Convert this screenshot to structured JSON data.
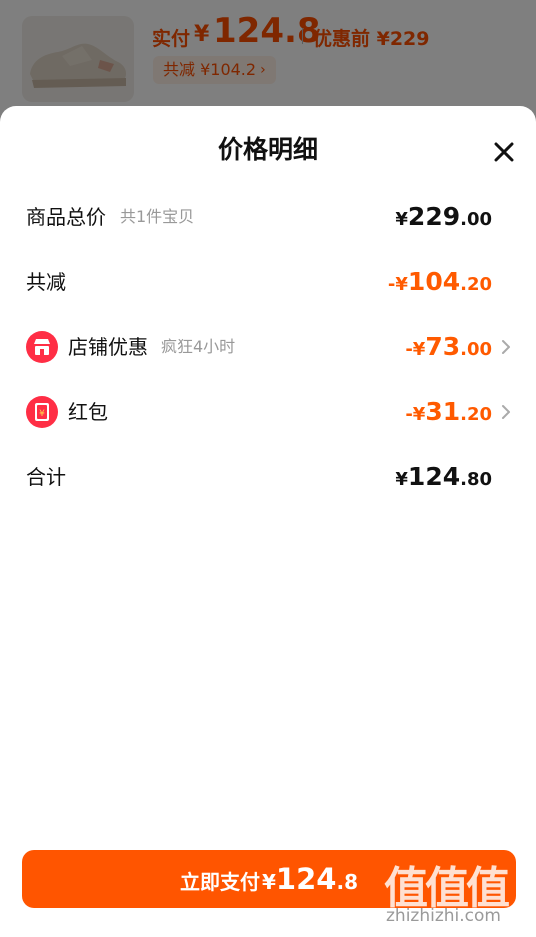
{
  "background": {
    "pay_label": "实付",
    "pay_yen": "¥",
    "pay_amount": "124.8",
    "before_label": "优惠前 ¥229",
    "reduce_chip": "共减 ¥104.2",
    "reduce_chevron": "›"
  },
  "sheet": {
    "title": "价格明细",
    "close_icon": "close-icon"
  },
  "rows": {
    "total": {
      "label": "商品总价",
      "sub": "共1件宝贝",
      "sym": "¥",
      "int": "229",
      "dec": ".00"
    },
    "reduced": {
      "label": "共减",
      "sym": "-¥",
      "int": "104",
      "dec": ".20"
    },
    "shop": {
      "label": "店铺优惠",
      "sub": "疯狂4小时",
      "sym": "-¥",
      "int": "73",
      "dec": ".00",
      "icon": "shop-icon"
    },
    "redpacket": {
      "label": "红包",
      "sym": "-¥",
      "int": "31",
      "dec": ".20",
      "icon": "red-packet-icon"
    },
    "sum": {
      "label": "合计",
      "sym": "¥",
      "int": "124",
      "dec": ".80"
    }
  },
  "pay_button": {
    "label": "立即支付",
    "sym": "¥",
    "int": "124",
    "dec": ".8"
  },
  "watermark": {
    "logo": "值值值",
    "site": "zhizhizhi.com"
  },
  "colors": {
    "accent": "#ff5500",
    "discount": "#ff5a00",
    "icon_red": "#ff2e45"
  }
}
